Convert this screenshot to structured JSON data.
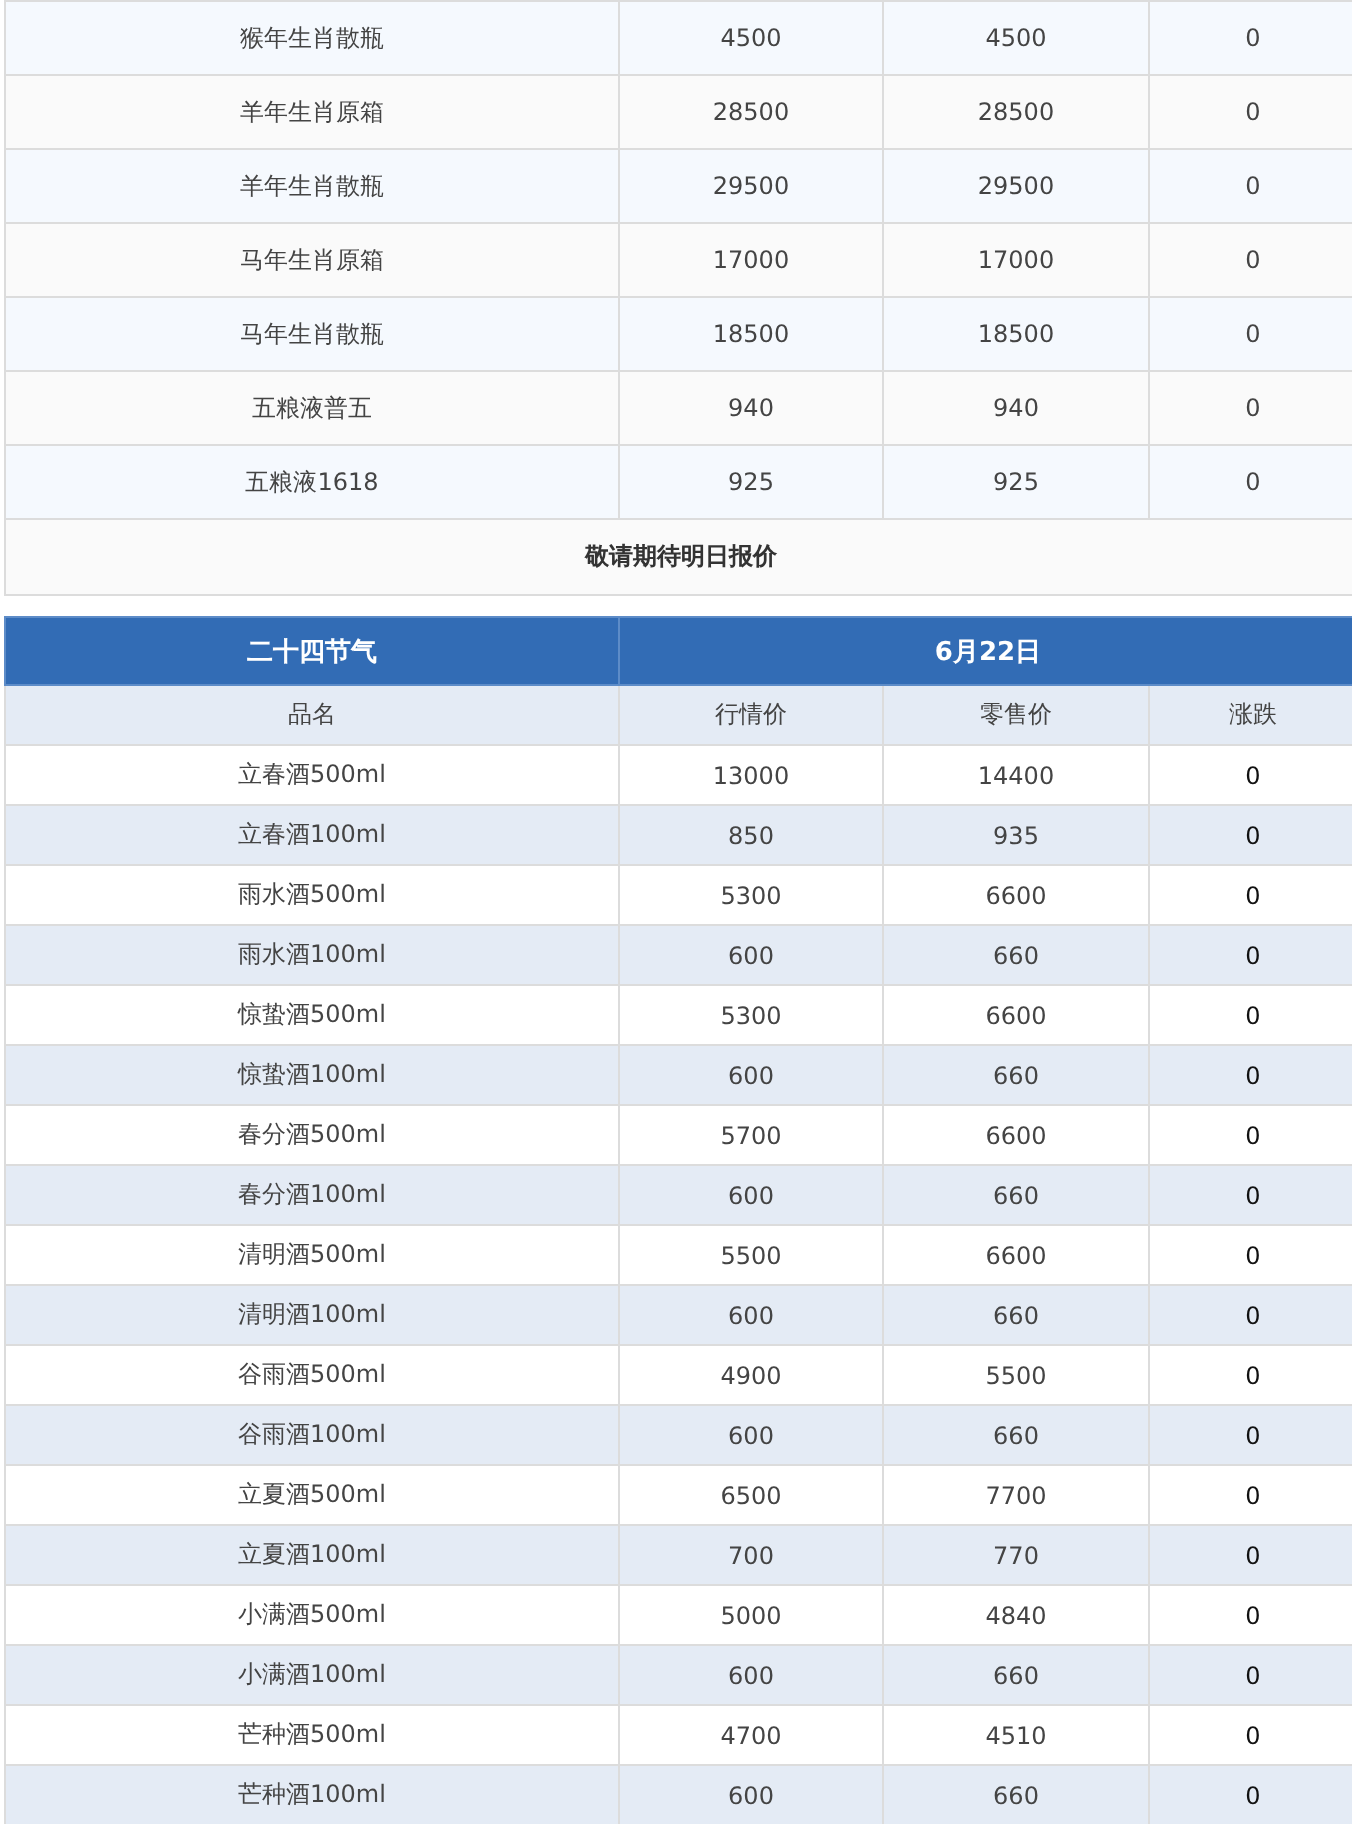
{
  "zodiac_table": {
    "rows": [
      {
        "name": "猴年生肖散瓶",
        "market_price": "4500",
        "retail_price": "4500",
        "change": "0"
      },
      {
        "name": "羊年生肖原箱",
        "market_price": "28500",
        "retail_price": "28500",
        "change": "0"
      },
      {
        "name": "羊年生肖散瓶",
        "market_price": "29500",
        "retail_price": "29500",
        "change": "0"
      },
      {
        "name": "马年生肖原箱",
        "market_price": "17000",
        "retail_price": "17000",
        "change": "0"
      },
      {
        "name": "马年生肖散瓶",
        "market_price": "18500",
        "retail_price": "18500",
        "change": "0"
      },
      {
        "name": "五粮液普五",
        "market_price": "940",
        "retail_price": "940",
        "change": "0"
      },
      {
        "name": "五粮液1618",
        "market_price": "925",
        "retail_price": "925",
        "change": "0"
      }
    ],
    "notice": "敬请期待明日报价"
  },
  "solar_terms_table": {
    "title": "二十四节气",
    "date": "6月22日",
    "columns": [
      "品名",
      "行情价",
      "零售价",
      "涨跌"
    ],
    "rows": [
      {
        "name": "立春酒500ml",
        "market_price": "13000",
        "retail_price": "14400",
        "change": "0"
      },
      {
        "name": "立春酒100ml",
        "market_price": "850",
        "retail_price": "935",
        "change": "0"
      },
      {
        "name": "雨水酒500ml",
        "market_price": "5300",
        "retail_price": "6600",
        "change": "0"
      },
      {
        "name": "雨水酒100ml",
        "market_price": "600",
        "retail_price": "660",
        "change": "0"
      },
      {
        "name": "惊蛰酒500ml",
        "market_price": "5300",
        "retail_price": "6600",
        "change": "0"
      },
      {
        "name": "惊蛰酒100ml",
        "market_price": "600",
        "retail_price": "660",
        "change": "0"
      },
      {
        "name": "春分酒500ml",
        "market_price": "5700",
        "retail_price": "6600",
        "change": "0"
      },
      {
        "name": "春分酒100ml",
        "market_price": "600",
        "retail_price": "660",
        "change": "0"
      },
      {
        "name": "清明酒500ml",
        "market_price": "5500",
        "retail_price": "6600",
        "change": "0"
      },
      {
        "name": "清明酒100ml",
        "market_price": "600",
        "retail_price": "660",
        "change": "0"
      },
      {
        "name": "谷雨酒500ml",
        "market_price": "4900",
        "retail_price": "5500",
        "change": "0"
      },
      {
        "name": "谷雨酒100ml",
        "market_price": "600",
        "retail_price": "660",
        "change": "0"
      },
      {
        "name": "立夏酒500ml",
        "market_price": "6500",
        "retail_price": "7700",
        "change": "0"
      },
      {
        "name": "立夏酒100ml",
        "market_price": "700",
        "retail_price": "770",
        "change": "0"
      },
      {
        "name": "小满酒500ml",
        "market_price": "5000",
        "retail_price": "4840",
        "change": "0"
      },
      {
        "name": "小满酒100ml",
        "market_price": "600",
        "retail_price": "660",
        "change": "0"
      },
      {
        "name": "芒种酒500ml",
        "market_price": "4700",
        "retail_price": "4510",
        "change": "0"
      },
      {
        "name": "芒种酒100ml",
        "market_price": "600",
        "retail_price": "660",
        "change": "0"
      }
    ]
  }
}
